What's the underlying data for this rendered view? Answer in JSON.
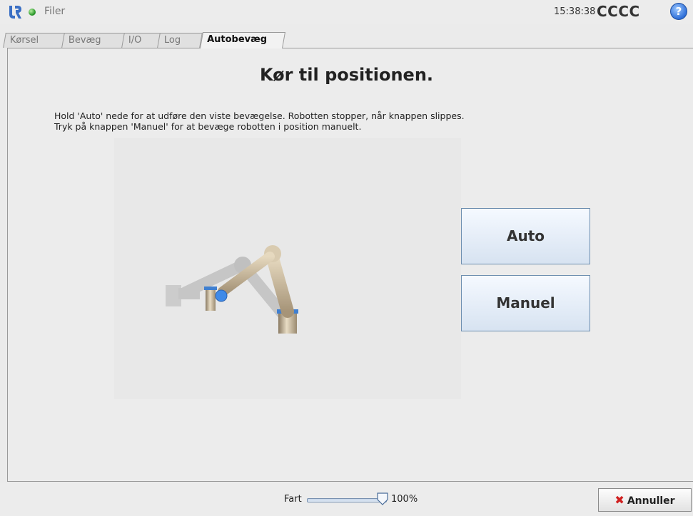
{
  "header": {
    "files_label": "Filer",
    "time": "15:38:38",
    "robot_name": "CCCC",
    "help_glyph": "?"
  },
  "tabs": [
    {
      "label": "Kørsel"
    },
    {
      "label": "Bevæg"
    },
    {
      "label": "I/O"
    },
    {
      "label": "Log"
    },
    {
      "label": "Autobevæg",
      "active": true
    }
  ],
  "main": {
    "title": "Kør til positionen.",
    "instruction_line1": "Hold 'Auto' nede for at udføre den viste bevægelse. Robotten stopper, når knappen slippes.",
    "instruction_line2": "Tryk på knappen 'Manuel' for at bevæge robotten i position manuelt.",
    "auto_label": "Auto",
    "manual_label": "Manuel"
  },
  "footer": {
    "speed_label": "Fart",
    "speed_value_text": "100%",
    "speed_value": 1.0,
    "cancel_label": "Annuller"
  },
  "colors": {
    "status": "#2f9b2f",
    "help": "#2f6fd8",
    "cancel_icon": "#d02020",
    "joint_ring": "#3f7fd0"
  }
}
